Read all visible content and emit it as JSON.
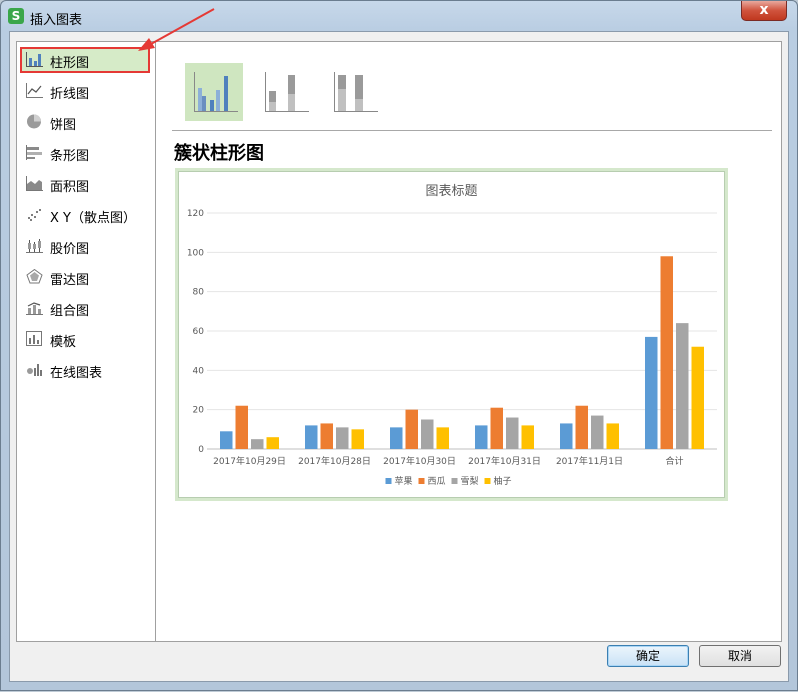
{
  "window": {
    "title": "插入图表",
    "icon": "wps-spreadsheet-icon",
    "close_label": "x"
  },
  "sidebar": {
    "items": [
      {
        "label": "柱形图",
        "icon": "bar-chart-icon",
        "selected": true
      },
      {
        "label": "折线图",
        "icon": "line-chart-icon",
        "selected": false
      },
      {
        "label": "饼图",
        "icon": "pie-chart-icon",
        "selected": false
      },
      {
        "label": "条形图",
        "icon": "horizontal-bar-chart-icon",
        "selected": false
      },
      {
        "label": "面积图",
        "icon": "area-chart-icon",
        "selected": false
      },
      {
        "label": "X Y（散点图）",
        "icon": "scatter-chart-icon",
        "selected": false
      },
      {
        "label": "股价图",
        "icon": "stock-chart-icon",
        "selected": false
      },
      {
        "label": "雷达图",
        "icon": "radar-chart-icon",
        "selected": false
      },
      {
        "label": "组合图",
        "icon": "combo-chart-icon",
        "selected": false
      },
      {
        "label": "模板",
        "icon": "template-icon",
        "selected": false
      },
      {
        "label": "在线图表",
        "icon": "online-chart-icon",
        "selected": false
      }
    ]
  },
  "subtypes": [
    {
      "icon": "clustered-column-icon",
      "active": true
    },
    {
      "icon": "stacked-column-icon",
      "active": false
    },
    {
      "icon": "percent-stacked-column-icon",
      "active": false
    }
  ],
  "main": {
    "section_title": "簇状柱形图"
  },
  "chart_data": {
    "type": "bar",
    "title": "图表标题",
    "categories": [
      "2017年10月29日",
      "2017年10月28日",
      "2017年10月30日",
      "2017年10月31日",
      "2017年11月1日",
      "合计"
    ],
    "series": [
      {
        "name": "苹果",
        "color": "#5b9bd5",
        "values": [
          9,
          12,
          11,
          12,
          13,
          57
        ]
      },
      {
        "name": "西瓜",
        "color": "#ed7d31",
        "values": [
          22,
          13,
          20,
          21,
          22,
          98
        ]
      },
      {
        "name": "雪梨",
        "color": "#a5a5a5",
        "values": [
          5,
          11,
          15,
          16,
          17,
          64
        ]
      },
      {
        "name": "柚子",
        "color": "#ffc000",
        "values": [
          6,
          10,
          11,
          12,
          13,
          52
        ]
      }
    ],
    "yticks": [
      "0",
      "20",
      "40",
      "60",
      "80",
      "100",
      "120"
    ],
    "ylim": [
      0,
      120
    ],
    "grid": true,
    "legend_position": "bottom"
  },
  "footer": {
    "ok_label": "确定",
    "cancel_label": "取消"
  },
  "colors": {
    "selection_highlight": "#d6ebc8",
    "annotation": "#e53935",
    "accent": "#3c7fb1"
  }
}
